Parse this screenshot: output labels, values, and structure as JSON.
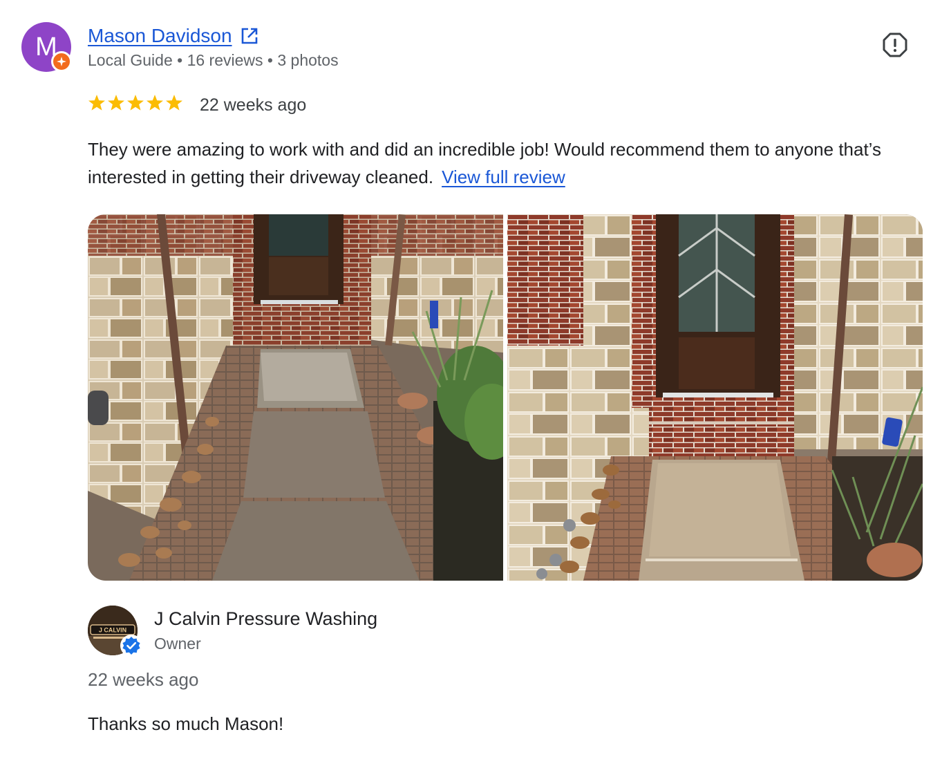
{
  "reviewer": {
    "initial": "M",
    "name": "Mason Davidson",
    "meta": "Local Guide • 16 reviews • 3 photos",
    "avatar_color": "#8e44c7",
    "badge_color": "#f26b1d"
  },
  "review": {
    "rating": 5,
    "stars": "★★★★★",
    "time": "22 weeks ago",
    "text": "They were amazing to work with and did an incredible job! Would recommend them to anyone that’s interested in getting their driveway cleaned.",
    "view_full_label": "View full review"
  },
  "photos": [
    {
      "name": "before-photo"
    },
    {
      "name": "after-photo"
    }
  ],
  "owner_response": {
    "name": "J Calvin Pressure Washing",
    "role": "Owner",
    "logo_text": "J CALVIN",
    "time": "22 weeks ago",
    "text": "Thanks so much Mason!"
  },
  "colors": {
    "link": "#1a57d6",
    "star": "#fbbc04",
    "verified": "#1a73e8",
    "muted_text": "#5f6368"
  },
  "icons": {
    "external_link": "external-link-icon",
    "report": "report-icon",
    "local_guide": "local-guide-badge-icon",
    "verified": "verified-check-icon"
  }
}
